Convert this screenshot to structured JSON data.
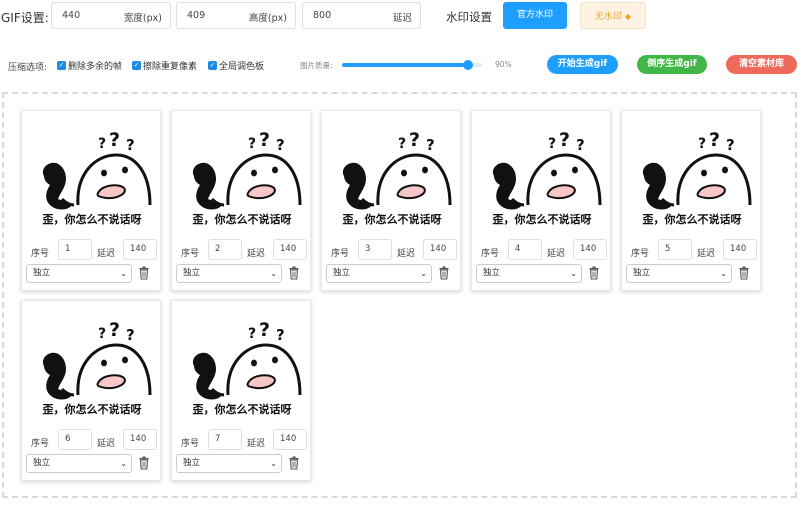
{
  "settings": {
    "gif_label": "GIF设置:",
    "width_value": "440",
    "width_unit": "宽度(px)",
    "height_value": "409",
    "height_unit": "高度(px)",
    "delay_value": "800",
    "delay_unit": "延迟",
    "watermark_label": "水印设置",
    "official_wm_label": "官方水印",
    "no_wm_label": "无水印"
  },
  "options": {
    "compress_label": "压缩选项:",
    "remove_extra_frames": "删除多余的帧",
    "remove_duplicate_pixels": "擦除重复像素",
    "global_palette": "全局调色板",
    "quality_label": "图片质量:",
    "quality_value": "90%",
    "quality_fraction": 0.9
  },
  "actions": {
    "start_label": "开始生成gif",
    "reverse_label": "倒序生成gif",
    "clear_label": "清空素材库"
  },
  "frames": [
    {
      "caption": "歪，你怎么不说话呀",
      "seq_label": "序号",
      "seq": "1",
      "delay_label": "延迟",
      "delay": "140",
      "mode": "独立"
    },
    {
      "caption": "歪，你怎么不说话呀",
      "seq_label": "序号",
      "seq": "2",
      "delay_label": "延迟",
      "delay": "140",
      "mode": "独立"
    },
    {
      "caption": "歪，你怎么不说话呀",
      "seq_label": "序号",
      "seq": "3",
      "delay_label": "延迟",
      "delay": "140",
      "mode": "独立"
    },
    {
      "caption": "歪，你怎么不说话呀",
      "seq_label": "序号",
      "seq": "4",
      "delay_label": "延迟",
      "delay": "140",
      "mode": "独立"
    },
    {
      "caption": "歪，你怎么不说话呀",
      "seq_label": "序号",
      "seq": "5",
      "delay_label": "延迟",
      "delay": "140",
      "mode": "独立"
    },
    {
      "caption": "歪，你怎么不说话呀",
      "seq_label": "序号",
      "seq": "6",
      "delay_label": "延迟",
      "delay": "140",
      "mode": "独立"
    },
    {
      "caption": "歪，你怎么不说话呀",
      "seq_label": "序号",
      "seq": "7",
      "delay_label": "延迟",
      "delay": "140",
      "mode": "独立"
    }
  ],
  "icons": {
    "gem": "diamond-icon",
    "checkbox": "checkmark-icon",
    "dropdown": "chevron-down-icon",
    "delete": "trash-icon"
  }
}
